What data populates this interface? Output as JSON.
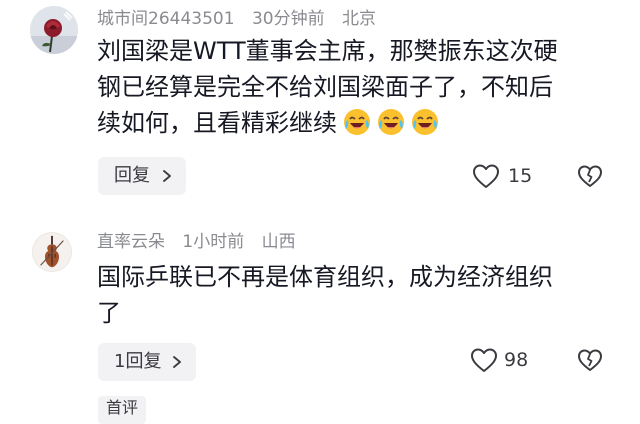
{
  "comments": [
    {
      "username": "城市间26443501",
      "time": "30分钟前",
      "location": "北京",
      "text_lines": [
        "刘国梁是WTT董事会主席，那樊振东这次硬",
        "钢已经算是完全不给刘国梁面子了，不知后",
        "续如何，且看精彩继续"
      ],
      "emojis": [
        "laughing-crying-emoji",
        "laughing-crying-emoji",
        "laughing-crying-emoji"
      ],
      "reply_label": "回复",
      "like_count": "15",
      "avatar_icon": "rose-avatar"
    },
    {
      "username": "直率云朵",
      "time": "1小时前",
      "location": "山西",
      "text_lines": [
        "国际乒联已不再是体育组织，成为经济组织",
        "了"
      ],
      "reply_label": "1回复",
      "like_count": "98",
      "avatar_icon": "violin-avatar"
    }
  ],
  "bottom_label": "首评",
  "colors": {
    "text": "#161823",
    "meta": "#8a8b91",
    "button_bg": "#f2f2f4"
  }
}
